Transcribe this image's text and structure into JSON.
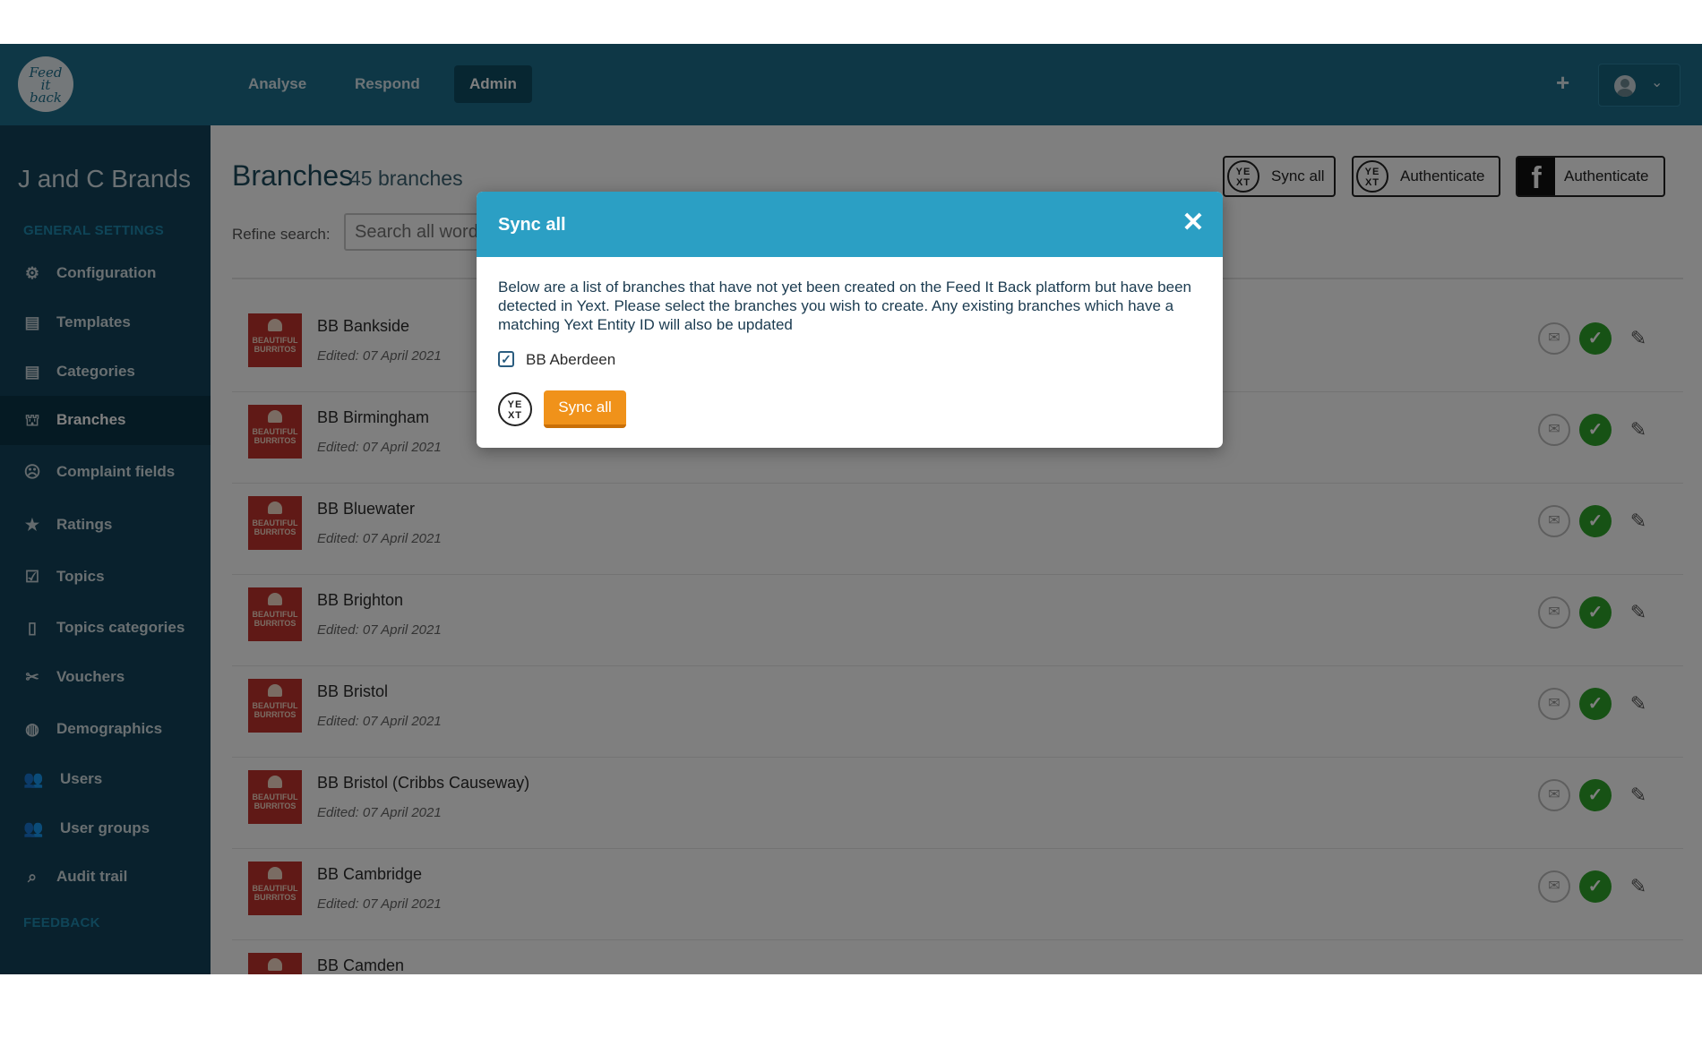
{
  "topbar": {
    "logo_lines": [
      "Feed",
      "it",
      "back"
    ],
    "nav": [
      "Analyse",
      "Respond",
      "Admin"
    ],
    "plus": "+",
    "chevron": "⌄"
  },
  "sidebar": {
    "client_name": "J and C Brands",
    "general_heading": "GENERAL SETTINGS",
    "feedback_heading": "FEEDBACK",
    "items": [
      {
        "label": "Configuration",
        "icon": "⚙"
      },
      {
        "label": "Templates",
        "icon": "▤"
      },
      {
        "label": "Categories",
        "icon": "▤"
      },
      {
        "label": "Branches",
        "icon": "⛫"
      },
      {
        "label": "Complaint fields",
        "icon": "☹"
      },
      {
        "label": "Ratings",
        "icon": "★"
      },
      {
        "label": "Topics",
        "icon": "☑"
      },
      {
        "label": "Topics categories",
        "icon": "▯"
      },
      {
        "label": "Vouchers",
        "icon": "✂"
      },
      {
        "label": "Demographics",
        "icon": "◍"
      },
      {
        "label": "Users",
        "icon": "👥"
      },
      {
        "label": "User groups",
        "icon": "👥"
      },
      {
        "label": "Audit trail",
        "icon": "⌕"
      }
    ]
  },
  "main": {
    "title": "Branches",
    "count": "45 branches",
    "refine_label": "Refine search:",
    "search_placeholder": "Search all words",
    "toolbar": {
      "yext_sync": "Sync all",
      "yext_auth": "Authenticate",
      "fb_auth": "Authenticate",
      "yext_glyph": "YE XT",
      "fb_glyph": "f"
    },
    "branches": [
      {
        "name": "BB Bankside",
        "edited": "Edited: 07 April 2021"
      },
      {
        "name": "BB Birmingham",
        "edited": "Edited: 07 April 2021"
      },
      {
        "name": "BB Bluewater",
        "edited": "Edited: 07 April 2021"
      },
      {
        "name": "BB Brighton",
        "edited": "Edited: 07 April 2021"
      },
      {
        "name": "BB Bristol",
        "edited": "Edited: 07 April 2021"
      },
      {
        "name": "BB Bristol (Cribbs Causeway)",
        "edited": "Edited: 07 April 2021"
      },
      {
        "name": "BB Cambridge",
        "edited": "Edited: 07 April 2021"
      },
      {
        "name": "BB Camden",
        "edited": ""
      }
    ],
    "branch_logo_text": "BEAUTIFUL BURRITOS",
    "row_icons": {
      "mail": "✉",
      "check": "✓",
      "edit": "✎"
    }
  },
  "modal": {
    "title": "Sync all",
    "close": "✕",
    "body": "Below are a list of branches that have not yet been created on the Feed It Back platform but have been detected in Yext. Please select the branches you wish to create. Any existing branches which have a matching Yext Entity ID will also be updated",
    "checkbox_label": "BB Aberdeen",
    "checkbox_mark": "✓",
    "sync_button": "Sync all",
    "yext_glyph": "YE XT"
  },
  "colors": {
    "topbar": "#1d6e8d",
    "sidebar": "#12435a",
    "modal_header": "#2b9fc4",
    "sync_button": "#f0921a",
    "check_green": "#2ea42a",
    "branch_logo": "#c0322d"
  }
}
